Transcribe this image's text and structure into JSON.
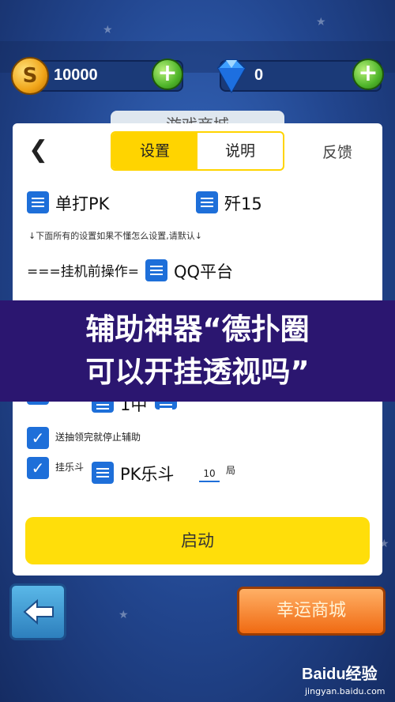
{
  "header": {
    "coins": "10000",
    "gems": "0"
  },
  "shop_title": "游戏商城",
  "panel": {
    "tabs": [
      {
        "label": "设置",
        "active": true
      },
      {
        "label": "说明",
        "active": false
      }
    ],
    "feedback_label": "反馈",
    "options_row1": [
      "单打PK",
      "歼15"
    ],
    "hint": "↓下面所有的设置如果不懂怎么设置,请默认↓",
    "pre_hang_prefix": "===挂机前操作=",
    "pre_hang_value": "QQ平台",
    "partial_row_text": "1中",
    "check_items": [
      {
        "label": "送抽领完就停止辅助",
        "checked": true
      },
      {
        "label": "挂乐斗",
        "checked": true,
        "mode": "PK乐斗",
        "rounds": "10",
        "unit": "局"
      }
    ],
    "start_label": "启动"
  },
  "overlay": {
    "line1": "辅助神器“德扑圈",
    "line2": "可以开挂透视吗”"
  },
  "bottom": {
    "lucky_shop_label": "幸运商城"
  },
  "watermark": {
    "logo": "Baidu经验",
    "url": "jingyan.baidu.com"
  },
  "colors": {
    "accent_yellow": "#ffd400",
    "checkbox_blue": "#1e6fd9",
    "overlay_purple": "#2b1670",
    "background_blue": "#22468f"
  }
}
